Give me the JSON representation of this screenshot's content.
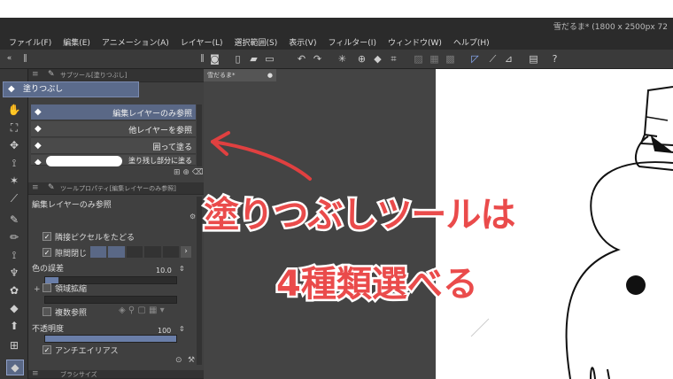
{
  "window": {
    "title": "雪だるま* (1800 x 2500px 72"
  },
  "menu": [
    "ファイル(F)",
    "編集(E)",
    "アニメーション(A)",
    "レイヤー(L)",
    "選択範囲(S)",
    "表示(V)",
    "フィルター(I)",
    "ウィンドウ(W)",
    "ヘルプ(H)"
  ],
  "subtool_panel": {
    "header": "サブツール[塗りつぶし]",
    "tab_label": "塗りつぶし",
    "items": [
      {
        "label": "編集レイヤーのみ参照",
        "selected": true
      },
      {
        "label": "他レイヤーを参照",
        "selected": false
      },
      {
        "label": "囲って塗る",
        "selected": false
      },
      {
        "label": "塗り残し部分に塗る",
        "selected": false
      }
    ]
  },
  "doc_tab": {
    "label": "雪だるま*"
  },
  "tool_property": {
    "header": "ツールプロパティ[編集レイヤーのみ参照]",
    "title": "編集レイヤーのみ参照",
    "rows": {
      "follow_adjacent": "隣接ピクセルをたどる",
      "close_gap": "隙間閉じ",
      "color_margin": "色の誤差",
      "color_margin_value": "10.0",
      "area_scaling": "領域拡縮",
      "multi_reference": "複数参照",
      "opacity": "不透明度",
      "opacity_value": "100",
      "antialiasing": "アンチエイリアス"
    },
    "color_margin_level": 0.1,
    "opacity_level": 1.0
  },
  "brush_size_header": "ブラシサイズ",
  "caption": {
    "line1": "塗りつぶしツールは",
    "line2": "4種類選べる"
  },
  "colors": {
    "caption": "#ea4b4b",
    "accent": "#5a6886",
    "panel": "#404040"
  }
}
